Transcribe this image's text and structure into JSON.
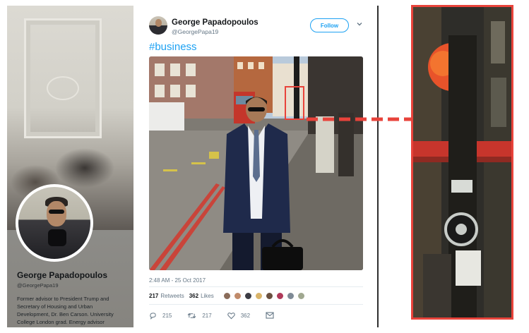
{
  "profile": {
    "name": "George Papadopoulos",
    "handle": "@GeorgePapa19",
    "bio": "Former advisor to President Trump and Secretary of Housing and Urban Development, Dr. Ben Carson. University College London grad. Energy advisor"
  },
  "tweet": {
    "author_name": "George Papadopoulos",
    "author_handle": "@GeorgePapa19",
    "follow_label": "Follow",
    "hashtag": "#business",
    "timestamp": "2:48 AM - 25 Oct 2017",
    "retweets_count": "217",
    "retweets_label": "Retweets",
    "likes_count": "362",
    "likes_label": "Likes",
    "actions": {
      "reply_count": "215",
      "retweet_count": "217",
      "like_count": "362"
    }
  },
  "icons": {
    "more": "chevron-down-icon",
    "reply": "reply-icon",
    "retweet": "retweet-icon",
    "like": "heart-icon",
    "message": "envelope-icon"
  },
  "colors": {
    "link_blue": "#1da1f2",
    "muted_text": "#657786",
    "highlight_red": "#e8433b"
  }
}
